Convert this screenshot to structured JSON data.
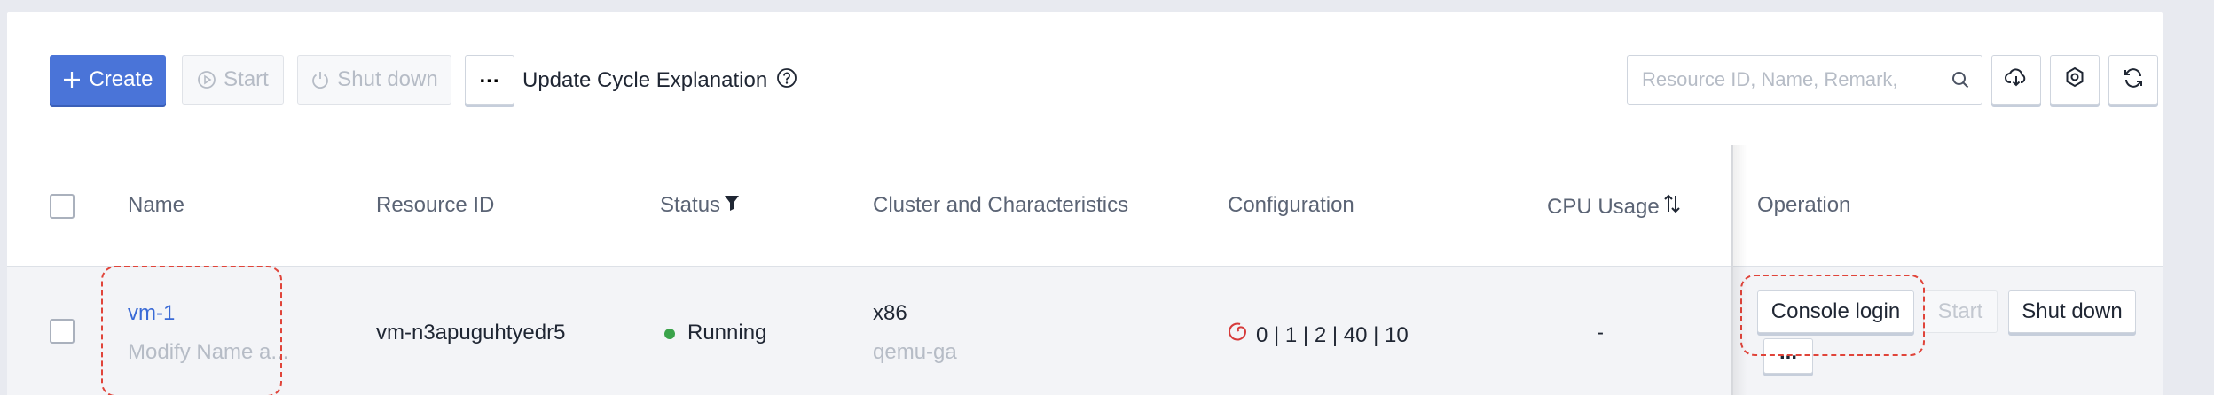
{
  "toolbar": {
    "create_label": "Create",
    "start_label": "Start",
    "shutdown_label": "Shut down",
    "more_label": "...",
    "update_cycle_label": "Update Cycle Explanation",
    "search_placeholder": "Resource ID, Name, Remark,",
    "icons": [
      "plus-icon",
      "play-icon",
      "power-icon",
      "help-icon",
      "search-icon",
      "download-cloud-icon",
      "gear-icon",
      "refresh-icon"
    ]
  },
  "table": {
    "headers": {
      "name": "Name",
      "resource_id": "Resource ID",
      "status": "Status",
      "cluster": "Cluster and Characteristics",
      "configuration": "Configuration",
      "cpu_usage": "CPU Usage",
      "operation": "Operation"
    },
    "rows": [
      {
        "name": "vm-1",
        "remark": "Modify Name a...",
        "resource_id": "vm-n3apuguhtyedr5",
        "status": "Running",
        "cluster": "x86",
        "characteristics": "qemu-ga",
        "configuration": "0 | 1 | 2 | 40 | 10",
        "cpu_usage": "-",
        "operations": {
          "console_login": "Console login",
          "start": "Start",
          "shutdown": "Shut down",
          "more": "..."
        }
      }
    ]
  },
  "colors": {
    "primary": "#4a74d8",
    "link": "#3a6ad6",
    "running": "#3aa34a",
    "highlight_dash": "#e0443a",
    "os_icon": "#d63a3a"
  }
}
